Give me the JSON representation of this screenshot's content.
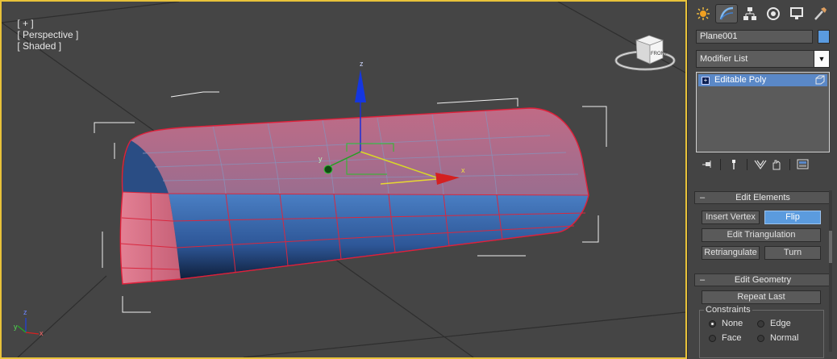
{
  "viewport": {
    "label_plus": "[ + ]",
    "label_view": "[ Perspective ]",
    "label_shading": "[ Shaded ]",
    "viewcube_face": "FRONT",
    "gizmo_z": "z",
    "gizmo_x": "x",
    "gizmo_y": "y",
    "axis_tripod": {
      "z": "z",
      "y": "y",
      "x": "x"
    },
    "colors": {
      "border": "#e8c23a",
      "mesh_top": "#c97088",
      "mesh_bottom": "#3d6fb8",
      "edge": "#e0203a"
    }
  },
  "command_panel": {
    "tabs": [
      "create-icon",
      "modify-icon",
      "hierarchy-icon",
      "motion-icon",
      "display-icon",
      "utilities-icon"
    ],
    "object_name": "Plane001",
    "object_color": "#5a9be0",
    "modifier_list": "Modifier List",
    "stack": [
      {
        "label": "Editable Poly",
        "icon": "cube-icon"
      }
    ],
    "stack_tools": [
      "pin-stack-icon",
      "show-end-result-icon",
      "make-unique-icon",
      "remove-modifier-icon",
      "configure-modifier-sets-icon"
    ]
  },
  "edit_elements": {
    "title": "Edit Elements",
    "insert_vertex": "Insert Vertex",
    "flip": "Flip",
    "edit_triangulation": "Edit Triangulation",
    "retriangulate": "Retriangulate",
    "turn": "Turn"
  },
  "edit_geometry": {
    "title": "Edit Geometry",
    "repeat_last": "Repeat Last",
    "constraints": {
      "title": "Constraints",
      "none": "None",
      "edge": "Edge",
      "face": "Face",
      "normal": "Normal",
      "selected": "None"
    }
  }
}
